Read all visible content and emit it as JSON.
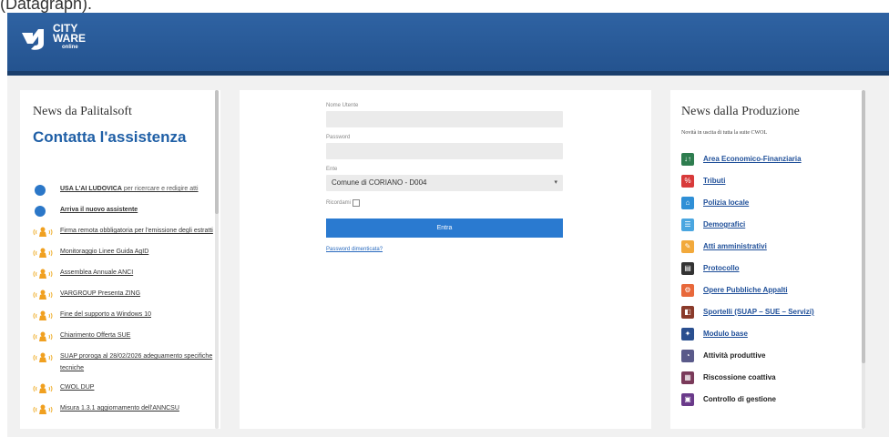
{
  "caption": "(Datagraph).",
  "logo": {
    "line1": "CITY",
    "line2": "WARE",
    "line3": "online"
  },
  "left_panel": {
    "title": "News da Palitalsoft",
    "contact": "Contatta l'assistenza",
    "news": [
      {
        "icon": "blue-badge-icon",
        "text": "USA L'AI LUDOVICA",
        "rest": " per ricercare e redigire atti",
        "bold": true
      },
      {
        "icon": "blue-badge-icon",
        "text": "Arriva il nuovo assistente",
        "rest": "",
        "bold": true
      },
      {
        "icon": "bell-icon",
        "text": "Firma remota obbligatoria per l'emissione degli estratti",
        "rest": "",
        "bold": false
      },
      {
        "icon": "bell-icon",
        "text": "Monitoraggio Linee Guida AgID",
        "rest": "",
        "bold": false
      },
      {
        "icon": "bell-icon",
        "text": "Assemblea Annuale ANCI",
        "rest": "",
        "bold": false
      },
      {
        "icon": "bell-icon",
        "text": "VARGROUP Presenta ZING",
        "rest": "",
        "bold": false
      },
      {
        "icon": "bell-icon",
        "text": "Fine del supporto a Windows 10",
        "rest": "",
        "bold": false
      },
      {
        "icon": "bell-icon",
        "text": "Chiarimento Offerta SUE",
        "rest": "",
        "bold": false
      },
      {
        "icon": "bell-icon",
        "text": "SUAP proroga al 28/02/2026 adeguamento specifiche tecniche",
        "rest": "",
        "bold": false
      },
      {
        "icon": "bell-icon",
        "text": "CWOL DUP",
        "rest": "",
        "bold": false
      },
      {
        "icon": "bell-icon",
        "text": "Misura 1.3.1 aggiornamento dell'ANNCSU",
        "rest": "",
        "bold": false
      }
    ]
  },
  "login": {
    "username_label": "Nome Utente",
    "username_value": "",
    "password_label": "Password",
    "password_value": "",
    "ente_label": "Ente",
    "ente_value": "Comune di CORIANO - D004",
    "remember_label": "Ricordami",
    "enter_label": "Entra",
    "forgot_label": "Password dimenticata?"
  },
  "right_panel": {
    "title": "News dalla Produzione",
    "subtitle": "Novità in uscita di tutta la suite CWOL",
    "items": [
      {
        "label": "Area Economico-Finanziaria",
        "color": "#2e7d4f",
        "glyph": "↓↑",
        "link": true
      },
      {
        "label": "Tributi",
        "color": "#d83a3a",
        "glyph": "%",
        "link": true
      },
      {
        "label": "Polizia locale",
        "color": "#2f8fd6",
        "glyph": "⌂",
        "link": true
      },
      {
        "label": "Demografici",
        "color": "#4aa6e0",
        "glyph": "☰",
        "link": true
      },
      {
        "label": "Atti amministrativi",
        "color": "#f2a93b",
        "glyph": "✎",
        "link": true
      },
      {
        "label": "Protocollo",
        "color": "#333333",
        "glyph": "▤",
        "link": true
      },
      {
        "label": "Opere Pubbliche Appalti",
        "color": "#e8683a",
        "glyph": "⚙",
        "link": true
      },
      {
        "label": "Sportelli (SUAP – SUE – Servizi)",
        "color": "#8a3a2a",
        "glyph": "◧",
        "link": true
      },
      {
        "label": "Modulo base",
        "color": "#2a4f8f",
        "glyph": "✦",
        "link": true
      },
      {
        "label": "Attività produttive",
        "color": "#5a5a8a",
        "glyph": "◔",
        "link": false
      },
      {
        "label": "Riscossione coattiva",
        "color": "#7a3a5a",
        "glyph": "▦",
        "link": false
      },
      {
        "label": "Controllo di gestione",
        "color": "#6a3a8a",
        "glyph": "▣",
        "link": false
      }
    ]
  }
}
